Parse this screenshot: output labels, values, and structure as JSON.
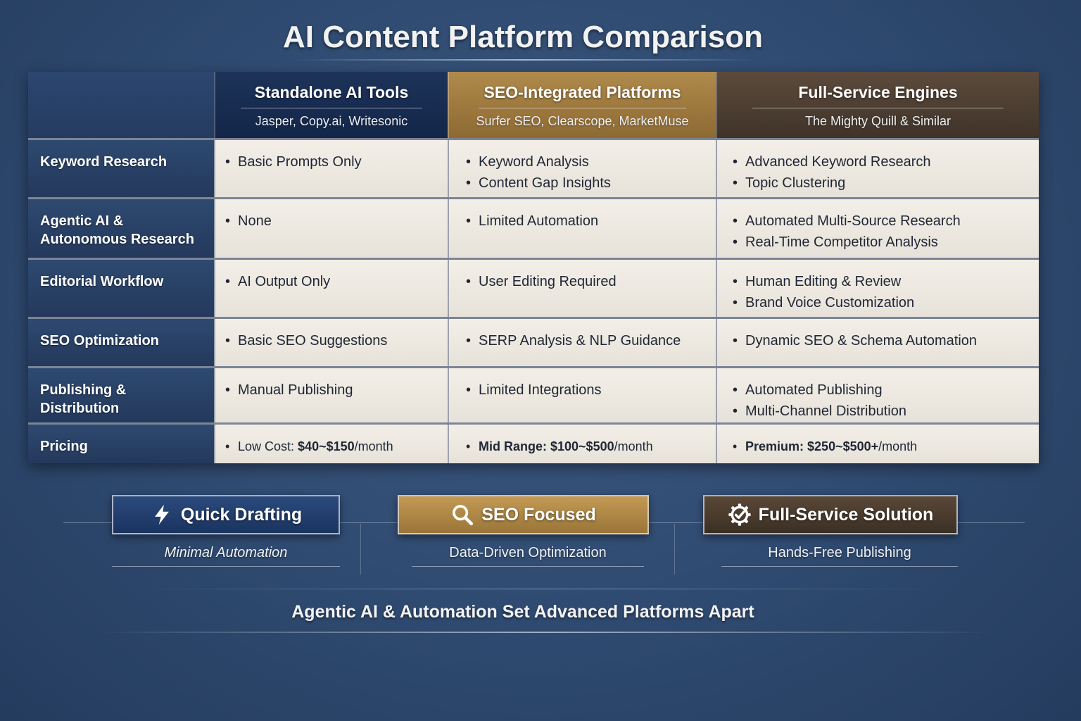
{
  "title": "AI Content Platform Comparison",
  "columns": [
    {
      "title": "Standalone AI Tools",
      "subtitle": "Jasper, Copy.ai, Writesonic"
    },
    {
      "title": "SEO-Integrated Platforms",
      "subtitle": "Surfer SEO, Clearscope, MarketMuse"
    },
    {
      "title": "Full-Service Engines",
      "subtitle": "The Mighty Quill & Similar"
    }
  ],
  "rows": [
    {
      "label": "Keyword Research",
      "cells": [
        [
          "Basic Prompts Only"
        ],
        [
          "Keyword Analysis",
          "Content Gap Insights"
        ],
        [
          "Advanced Keyword Research",
          "Topic Clustering"
        ]
      ]
    },
    {
      "label": "Agentic AI & Autonomous Research",
      "cells": [
        [
          "None"
        ],
        [
          "Limited Automation"
        ],
        [
          "Automated Multi-Source Research",
          "Real-Time Competitor Analysis"
        ]
      ]
    },
    {
      "label": "Editorial Workflow",
      "cells": [
        [
          "AI Output Only"
        ],
        [
          "User Editing Required"
        ],
        [
          "Human Editing & Review",
          "Brand Voice Customization"
        ]
      ]
    },
    {
      "label": "SEO Optimization",
      "cells": [
        [
          "Basic SEO Suggestions"
        ],
        [
          "SERP Analysis & NLP Guidance"
        ],
        [
          "Dynamic SEO & Schema Automation"
        ]
      ]
    },
    {
      "label": "Publishing & Distribution",
      "cells": [
        [
          "Manual Publishing"
        ],
        [
          "Limited Integrations"
        ],
        [
          "Automated Publishing",
          "Multi-Channel Distribution"
        ]
      ]
    }
  ],
  "pricing": {
    "label": "Pricing",
    "cells": [
      {
        "prefix": "Low Cost: ",
        "amount": "$40~$150",
        "suffix": "/month"
      },
      {
        "prefix": "Mid Range: ",
        "amount": "$100~$500",
        "suffix": "/month"
      },
      {
        "prefix": "Premium: ",
        "amount": "$250~$500+",
        "suffix": "/month"
      }
    ]
  },
  "badges": [
    {
      "label": "Quick Drafting",
      "caption": "Minimal Automation",
      "icon": "lightning-icon"
    },
    {
      "label": "SEO Focused",
      "caption": "Data-Driven Optimization",
      "icon": "magnifier-icon"
    },
    {
      "label": "Full-Service Solution",
      "caption": "Hands-Free Publishing",
      "icon": "gear-check-icon"
    }
  ],
  "footer": "Agentic AI & Automation Set Advanced Platforms Apart"
}
